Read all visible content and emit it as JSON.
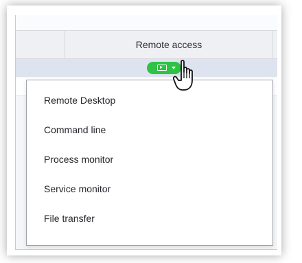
{
  "table": {
    "header": {
      "remote_access": "Remote access"
    },
    "remote_button": {
      "icon": "remote-desktop-icon",
      "accent_color": "#2fc244"
    }
  },
  "remote_menu": {
    "items": [
      {
        "label": "Remote Desktop"
      },
      {
        "label": "Command line"
      },
      {
        "label": "Process monitor"
      },
      {
        "label": "Service monitor"
      },
      {
        "label": "File transfer"
      }
    ]
  },
  "cursor": {
    "icon": "hand-pointer-icon"
  }
}
